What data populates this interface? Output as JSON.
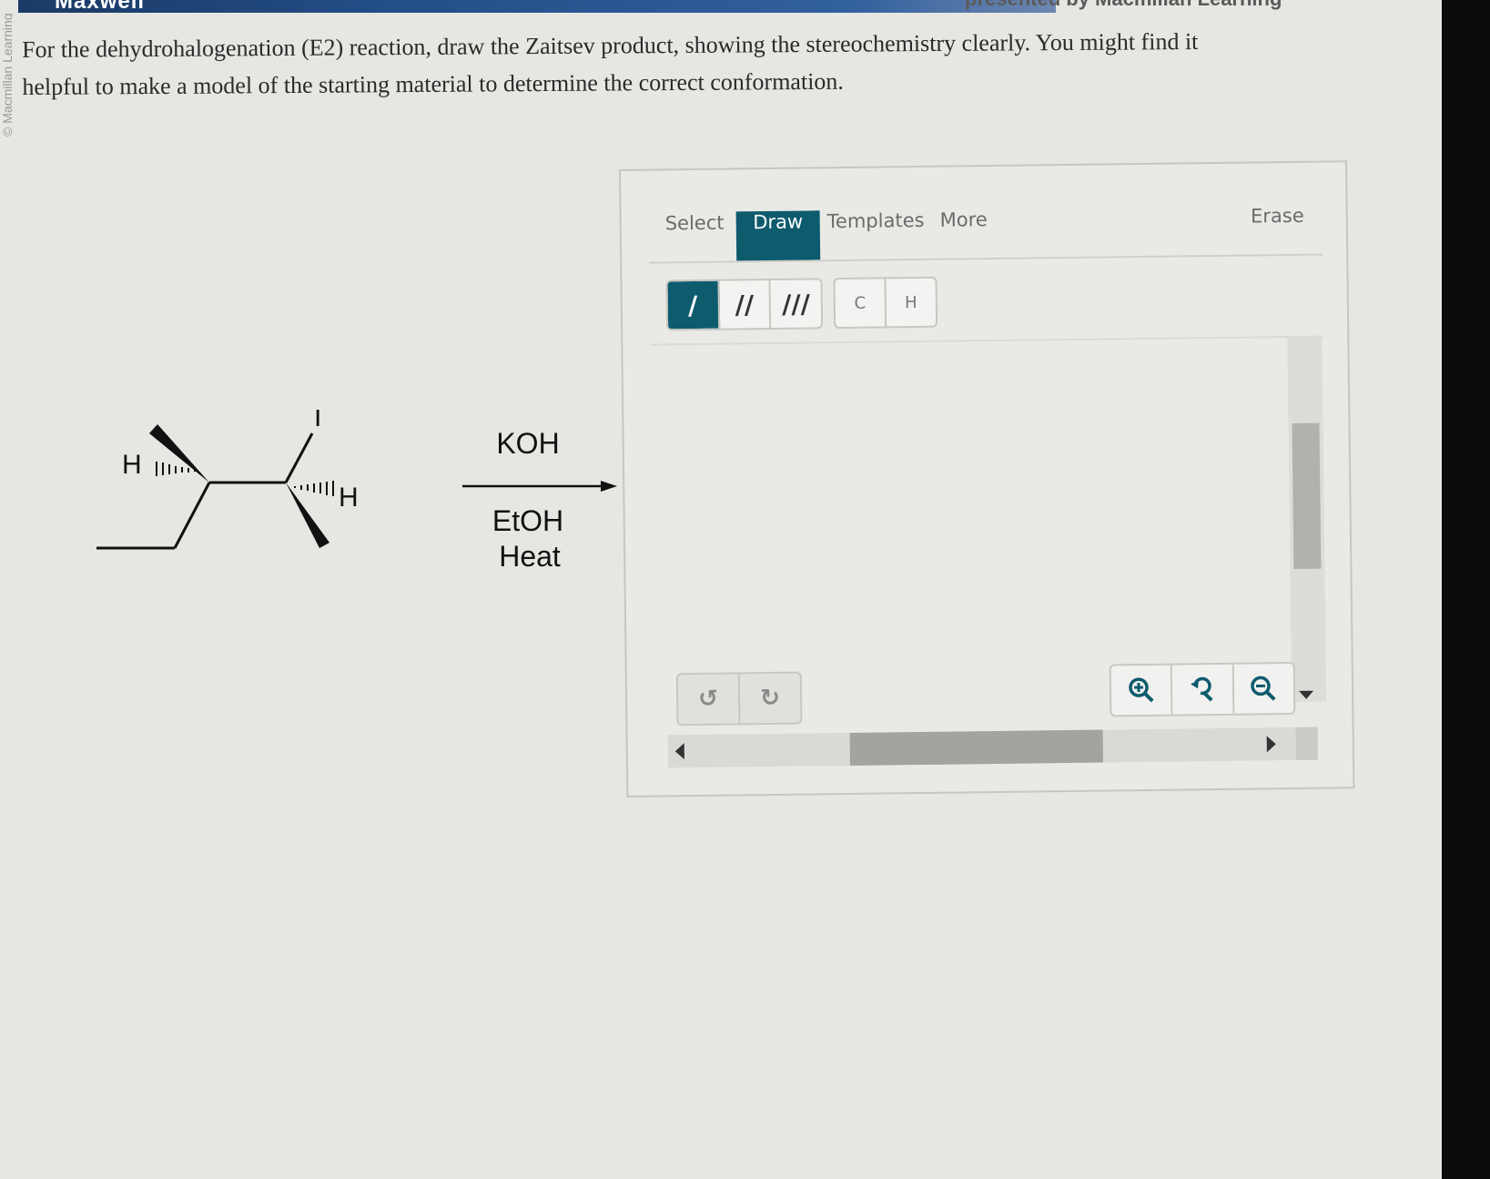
{
  "header": {
    "title": "Maxwell",
    "presented_by": "presented by Macmillan Learning"
  },
  "side_credit": "© Macmillan Learning",
  "question": {
    "line1": "For the dehydrohalogenation (E2) reaction, draw the Zaitsev product, showing the stereochemistry clearly. You might find it",
    "line2": "helpful to make a model of the starting material to determine the correct conformation."
  },
  "reaction": {
    "reagent_above": "KOH",
    "solvent": "EtOH",
    "condition": "Heat",
    "atoms": {
      "iodine": "I",
      "h_left": "H",
      "h_right": "H"
    }
  },
  "editor": {
    "menu": {
      "select": "Select",
      "draw": "Draw",
      "templates": "Templates",
      "more": "More",
      "erase": "Erase"
    },
    "bond_tools": [
      "/",
      "//",
      "///"
    ],
    "atom_tools": [
      "C",
      "H"
    ],
    "history_icons": [
      "undo-icon",
      "redo-icon"
    ],
    "zoom_icons": [
      "zoom-in-icon",
      "zoom-reset-icon",
      "zoom-out-icon"
    ]
  },
  "colors": {
    "accent": "#0e5b6e",
    "banner": "#24508a"
  }
}
